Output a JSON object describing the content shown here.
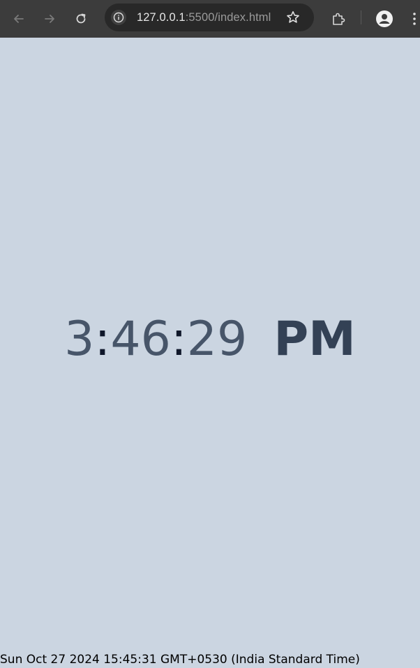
{
  "browser": {
    "url_host": "127.0.0.1",
    "url_path": ":5500/index.html",
    "back_icon": "arrow-left-icon",
    "forward_icon": "arrow-right-icon",
    "reload_icon": "reload-icon",
    "site_info_icon": "info-icon",
    "bookmark_icon": "star-icon",
    "extensions_icon": "puzzle-icon",
    "profile_icon": "profile-icon",
    "menu_icon": "kebab-menu-icon",
    "toolbar_color": "#3c3c3c",
    "omnibox_color": "#282828"
  },
  "clock": {
    "hours": "3",
    "sep1": ":",
    "minutes": "46",
    "sep2": ":",
    "seconds": "29",
    "ampm": "PM",
    "digit_color": "#475569",
    "colon_color": "#0f172a",
    "ampm_color": "#334155"
  },
  "page": {
    "background": "#cbd5e1",
    "date_string": "Sun Oct 27 2024 15:45:31 GMT+0530 (India Standard Time)"
  }
}
